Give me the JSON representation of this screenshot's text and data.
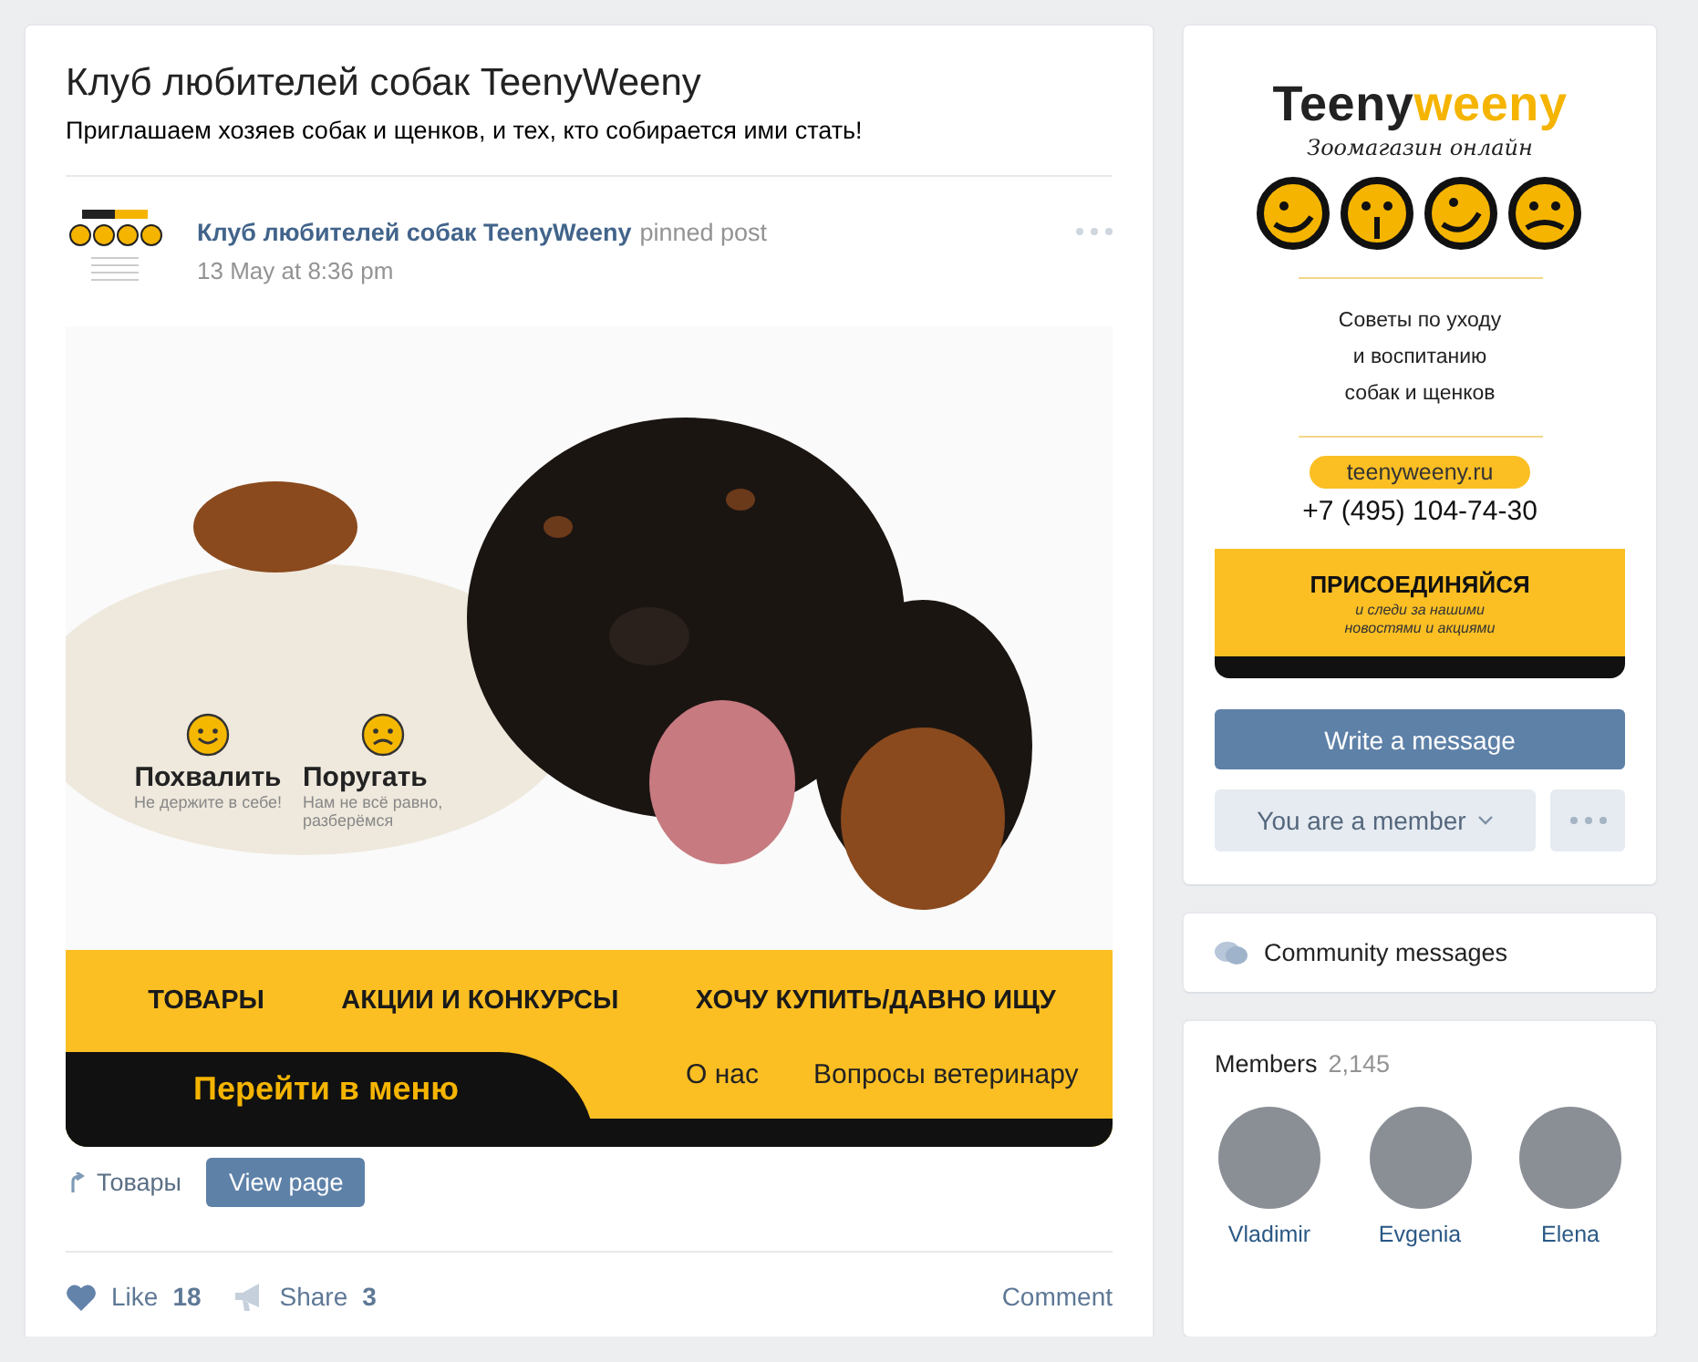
{
  "group": {
    "title": "Клуб любителей собак TeenyWeeny",
    "description": "Приглашаем хозяев собак и щенков, и тех, кто собирается ими стать!"
  },
  "post": {
    "author": "Клуб любителей собак TeenyWeeny",
    "badge": "pinned post",
    "time": "13 May at 8:36 pm",
    "image": {
      "reactions": [
        {
          "kind": "happy",
          "title": "Похвалить",
          "subtitle": "Не держите в себе!"
        },
        {
          "kind": "sad",
          "title": "Поругать",
          "subtitle": "Нам не всё равно, разберёмся"
        }
      ],
      "menu_top": [
        "ТОВАРЫ",
        "АКЦИИ И КОНКУРСЫ",
        "ХОЧУ КУПИТЬ/ДАВНО ИЩУ"
      ],
      "menu_button": "Перейти в меню",
      "menu_links": [
        "О нас",
        "Вопросы ветеринару"
      ]
    },
    "link": {
      "label": "Товары",
      "button": "View page"
    },
    "actions": [
      {
        "kind": "like",
        "label": "Like",
        "count": "18"
      },
      {
        "kind": "share",
        "label": "Share",
        "count": "3"
      }
    ],
    "comment": "Comment"
  },
  "sidebar": {
    "cover": {
      "brand_parts": [
        "Teeny",
        "weeny"
      ],
      "tagline": "Зоомагазин онлайн",
      "tips": "Советы по уходу\nи воспитанию\nсобак и щенков",
      "site": "teenyweeny.ru",
      "phone": "+7 (495) 104-74-30",
      "join_title": "ПРИСОЕДИНЯЙСЯ",
      "join_subtitle": "и следи за нашими\nновостями и акциями"
    },
    "write_button": "Write a message",
    "member_button": "You are a member",
    "community_messages": "Community messages",
    "members": {
      "label": "Members",
      "count": "2,145",
      "people": [
        {
          "name": "Vladimir"
        },
        {
          "name": "Evgenia"
        },
        {
          "name": "Elena"
        }
      ]
    }
  }
}
